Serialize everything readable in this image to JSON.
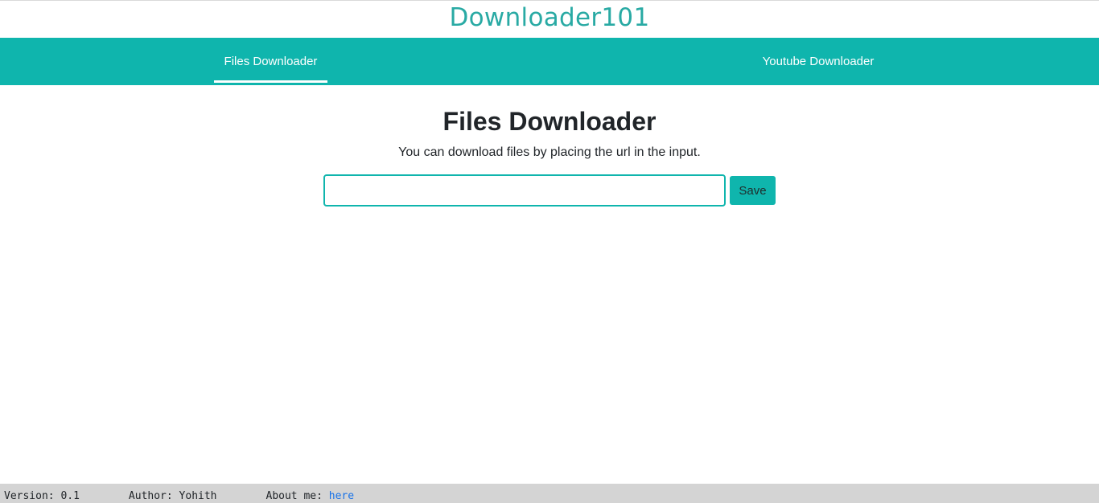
{
  "header": {
    "brand": "Downloader101"
  },
  "nav": {
    "tabs": [
      {
        "label": "Files Downloader",
        "active": true
      },
      {
        "label": "Youtube Downloader",
        "active": false
      }
    ]
  },
  "main": {
    "title": "Files Downloader",
    "description": "You can download files by placing the url in the input.",
    "url_input_value": "",
    "url_input_placeholder": "",
    "save_label": "Save"
  },
  "footer": {
    "version_label": "Version: 0.1",
    "author_label": "Author: Yohith",
    "about_label": "About me: ",
    "about_link": "here"
  },
  "colors": {
    "accent": "#0fb5ad",
    "brand_text": "#29aaa4",
    "footer_bg": "#d4d4d4",
    "link": "#1a73e8"
  }
}
